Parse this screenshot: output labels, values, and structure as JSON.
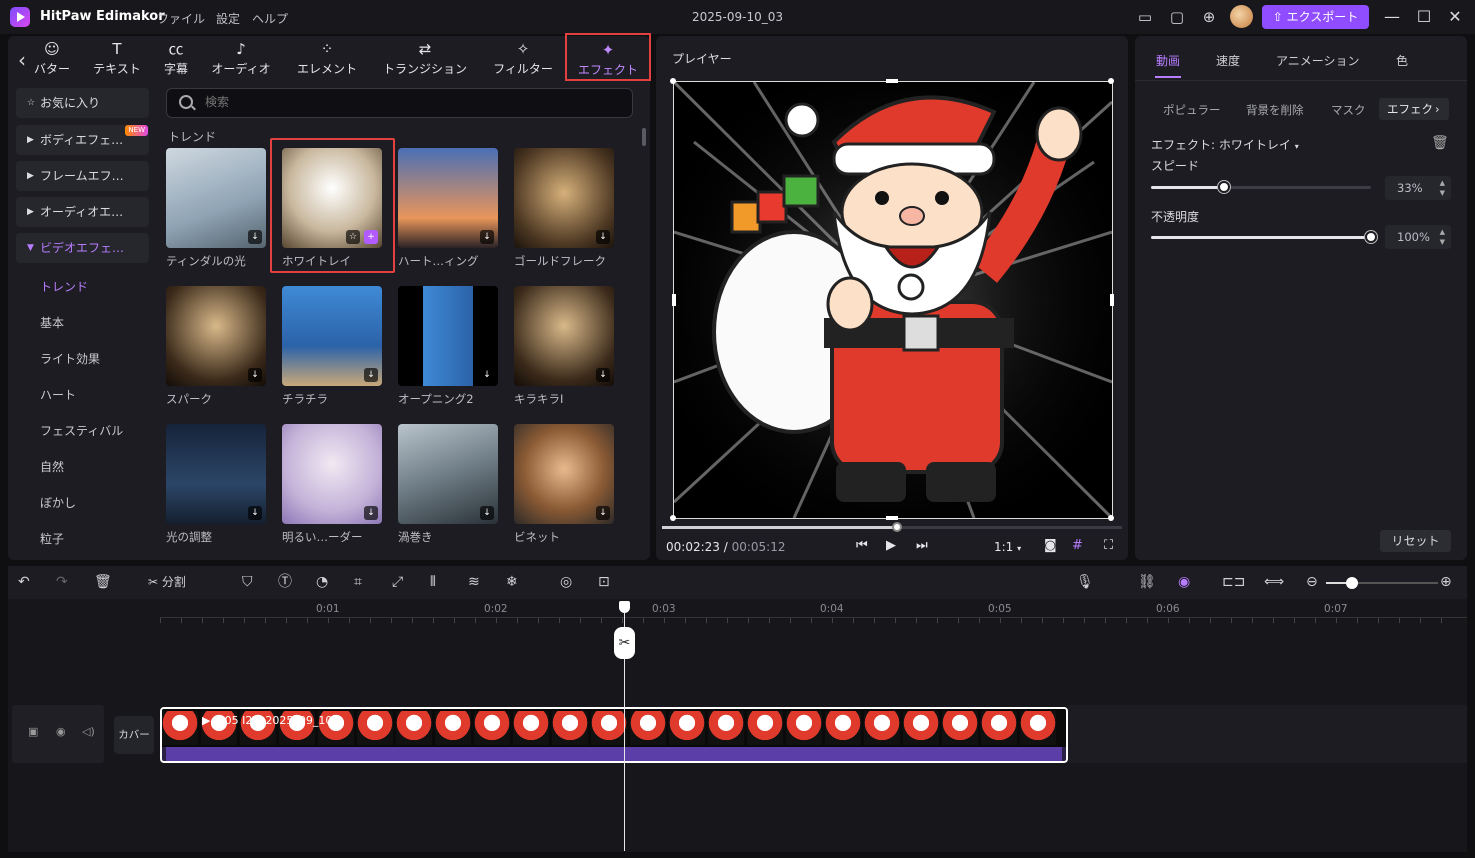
{
  "titlebar": {
    "app_name": "HitPaw Edimakor",
    "menus": [
      "ファイル",
      "設定",
      "ヘルプ"
    ],
    "project_name": "2025-09-10_03",
    "export_label": "エクスポート"
  },
  "toolbar": {
    "tools": [
      {
        "label": "バター",
        "icon": "avatar-icon"
      },
      {
        "label": "テキスト",
        "icon": "text-icon"
      },
      {
        "label": "字幕",
        "icon": "subtitle-icon"
      },
      {
        "label": "オーディオ",
        "icon": "audio-icon"
      },
      {
        "label": "エレメント",
        "icon": "element-icon"
      },
      {
        "label": "トランジション",
        "icon": "transition-icon"
      },
      {
        "label": "フィルター",
        "icon": "filter-icon"
      },
      {
        "label": "エフェクト",
        "icon": "effect-icon"
      }
    ]
  },
  "search": {
    "placeholder": "検索"
  },
  "categories": {
    "favorites": "お気に入り",
    "body": "ボディエフェ…",
    "body_badge": "NEW",
    "frame": "フレームエフ…",
    "audio": "オーディオエ…",
    "video": "ビデオエフェ…",
    "subs": [
      "トレンド",
      "基本",
      "ライト効果",
      "ハート",
      "フェスティバル",
      "自然",
      "ぼかし",
      "粒子"
    ]
  },
  "section_label": "トレンド",
  "effects": [
    "ティンダルの光",
    "ホワイトレイ",
    "ハート…ィング",
    "ゴールドフレーク",
    "スパーク",
    "チラチラ",
    "オープニング2",
    "キラキラⅠ",
    "光の調整",
    "明るい…ーダー",
    "渦巻き",
    "ビネット"
  ],
  "player": {
    "title": "プレイヤー",
    "current_time": "00:02:23",
    "total_time": "00:05:12",
    "ratio": "1:1",
    "progress": 0.51
  },
  "right": {
    "tabs": [
      "動画",
      "速度",
      "アニメーション",
      "色"
    ],
    "subtabs": [
      "ポピュラー",
      "背景を削除",
      "マスク",
      "エフェク"
    ],
    "effect_name": "エフェクト: ホワイトレイ",
    "speed_label": "スピード",
    "speed_value": "33%",
    "speed": 0.33,
    "opacity_label": "不透明度",
    "opacity_value": "100%",
    "opacity": 1.0,
    "reset_label": "リセット"
  },
  "timeline": {
    "split_label": "分割",
    "ticks": [
      "0:01",
      "0:02",
      "0:03",
      "0:04",
      "0:05",
      "0:06",
      "0:07"
    ],
    "cover_label": "カバー",
    "clip_title": "0:05 I2V_2025_09_10"
  },
  "colors": {
    "accent": "#8f4dff",
    "highlight": "#e34040",
    "clip": "#5c3ea8"
  }
}
